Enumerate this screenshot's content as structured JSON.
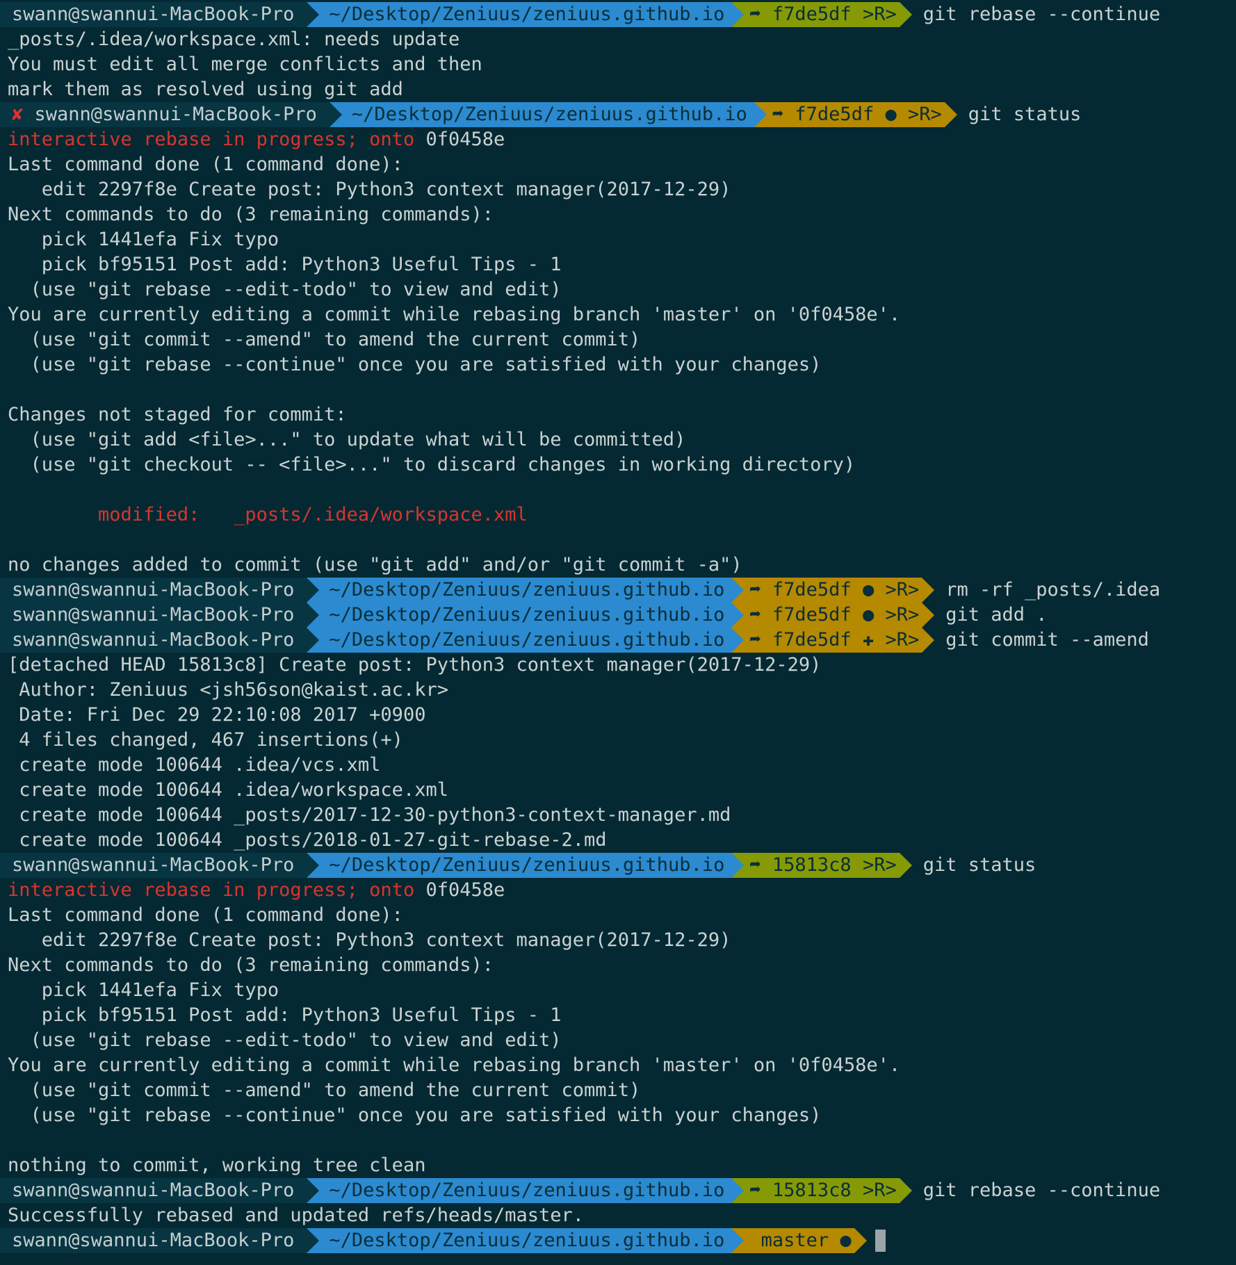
{
  "colors": {
    "background": "#042933",
    "context_segment": "#073542",
    "dir_segment": "#2b8ad0",
    "git_dirty_segment": "#b58900",
    "git_clean_segment": "#869a06",
    "error_text": "#d8352e",
    "text": "#cad2d2"
  },
  "prompt": {
    "context": "swann@swannui-MacBook-Pro",
    "dir": "~/Desktop/Zeniuus/zeniuus.github.io",
    "rebase_marker": ">R>",
    "branch_icon": "➦",
    "dirty_icon": "●",
    "staged_icon": "✚",
    "error_icon": "✘",
    "branch_symbol": ""
  },
  "lines": {
    "l01": {
      "hash": "f7de5df",
      "cmd": "git rebase --continue"
    },
    "l02": "_posts/.idea/workspace.xml: needs update",
    "l03": "You must edit all merge conflicts and then",
    "l04": "mark them as resolved using git add",
    "l05": {
      "hash": "f7de5df",
      "cmd": "git status"
    },
    "l06_red": "interactive rebase in progress; onto",
    "l06_rest": " 0f0458e",
    "l07": "Last command done (1 command done):",
    "l08": "   edit 2297f8e Create post: Python3 context manager(2017-12-29)",
    "l09": "Next commands to do (3 remaining commands):",
    "l10": "   pick 1441efa Fix typo",
    "l11": "   pick bf95151 Post add: Python3 Useful Tips - 1",
    "l12": "  (use \"git rebase --edit-todo\" to view and edit)",
    "l13": "You are currently editing a commit while rebasing branch 'master' on '0f0458e'.",
    "l14": "  (use \"git commit --amend\" to amend the current commit)",
    "l15": "  (use \"git rebase --continue\" once you are satisfied with your changes)",
    "l17": "Changes not staged for commit:",
    "l18": "  (use \"git add <file>...\" to update what will be committed)",
    "l19": "  (use \"git checkout -- <file>...\" to discard changes in working directory)",
    "l21": "        modified:   _posts/.idea/workspace.xml",
    "l23": "no changes added to commit (use \"git add\" and/or \"git commit -a\")",
    "l24": {
      "hash": "f7de5df",
      "cmd": "rm -rf _posts/.idea"
    },
    "l25": {
      "hash": "f7de5df",
      "cmd": "git add ."
    },
    "l26": {
      "hash": "f7de5df",
      "cmd": "git commit --amend"
    },
    "l27": "[detached HEAD 15813c8] Create post: Python3 context manager(2017-12-29)",
    "l28": " Author: Zeniuus <jsh56son@kaist.ac.kr>",
    "l29": " Date: Fri Dec 29 22:10:08 2017 +0900",
    "l30": " 4 files changed, 467 insertions(+)",
    "l31": " create mode 100644 .idea/vcs.xml",
    "l32": " create mode 100644 .idea/workspace.xml",
    "l33": " create mode 100644 _posts/2017-12-30-python3-context-manager.md",
    "l34": " create mode 100644 _posts/2018-01-27-git-rebase-2.md",
    "l35": {
      "hash": "15813c8",
      "cmd": "git status"
    },
    "l36_red": "interactive rebase in progress; onto",
    "l36_rest": " 0f0458e",
    "l37": "Last command done (1 command done):",
    "l38": "   edit 2297f8e Create post: Python3 context manager(2017-12-29)",
    "l39": "Next commands to do (3 remaining commands):",
    "l40": "   pick 1441efa Fix typo",
    "l41": "   pick bf95151 Post add: Python3 Useful Tips - 1",
    "l42": "  (use \"git rebase --edit-todo\" to view and edit)",
    "l43": "You are currently editing a commit while rebasing branch 'master' on '0f0458e'.",
    "l44": "  (use \"git commit --amend\" to amend the current commit)",
    "l45": "  (use \"git rebase --continue\" once you are satisfied with your changes)",
    "l47": "nothing to commit, working tree clean",
    "l48": {
      "hash": "15813c8",
      "cmd": "git rebase --continue"
    },
    "l49": "Successfully rebased and updated refs/heads/master.",
    "l50": {
      "branch": "master"
    }
  }
}
